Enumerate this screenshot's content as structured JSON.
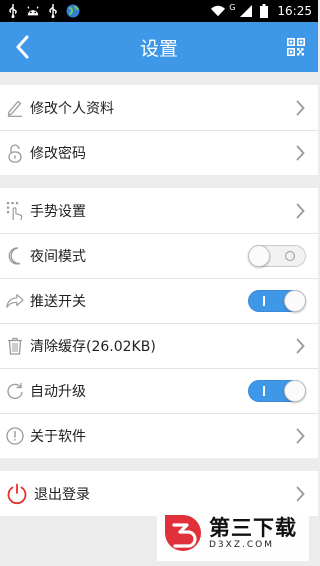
{
  "status_bar": {
    "time": "16:25",
    "network_label": "G",
    "icons": [
      "usb-icon",
      "android-icon",
      "usb-icon",
      "globe-icon",
      "wifi-icon",
      "signal-icon",
      "battery-icon"
    ]
  },
  "app_bar": {
    "title": "设置",
    "back_icon": "back-arrow-icon",
    "action_icon": "qr-code-icon",
    "color": "#3f97e7"
  },
  "groups": [
    {
      "items": [
        {
          "label": "修改个人资料",
          "icon": "pencil-icon",
          "control": "chevron"
        },
        {
          "label": "修改密码",
          "icon": "lock-icon",
          "control": "chevron"
        }
      ]
    },
    {
      "items": [
        {
          "label": "手势设置",
          "icon": "gesture-icon",
          "control": "chevron"
        },
        {
          "label": "夜间模式",
          "icon": "moon-icon",
          "control": "toggle",
          "on": false
        },
        {
          "label": "推送开关",
          "icon": "share-icon",
          "control": "toggle",
          "on": true
        },
        {
          "label": "清除缓存(26.02KB)",
          "icon": "trash-icon",
          "control": "chevron"
        },
        {
          "label": "自动升级",
          "icon": "refresh-icon",
          "control": "toggle",
          "on": true
        },
        {
          "label": "关于软件",
          "icon": "info-icon",
          "control": "chevron"
        }
      ]
    },
    {
      "items": [
        {
          "label": "退出登录",
          "icon": "power-icon",
          "control": "chevron"
        }
      ]
    }
  ],
  "watermark": {
    "title": "第三下载",
    "url": "D3XZ.COM"
  }
}
